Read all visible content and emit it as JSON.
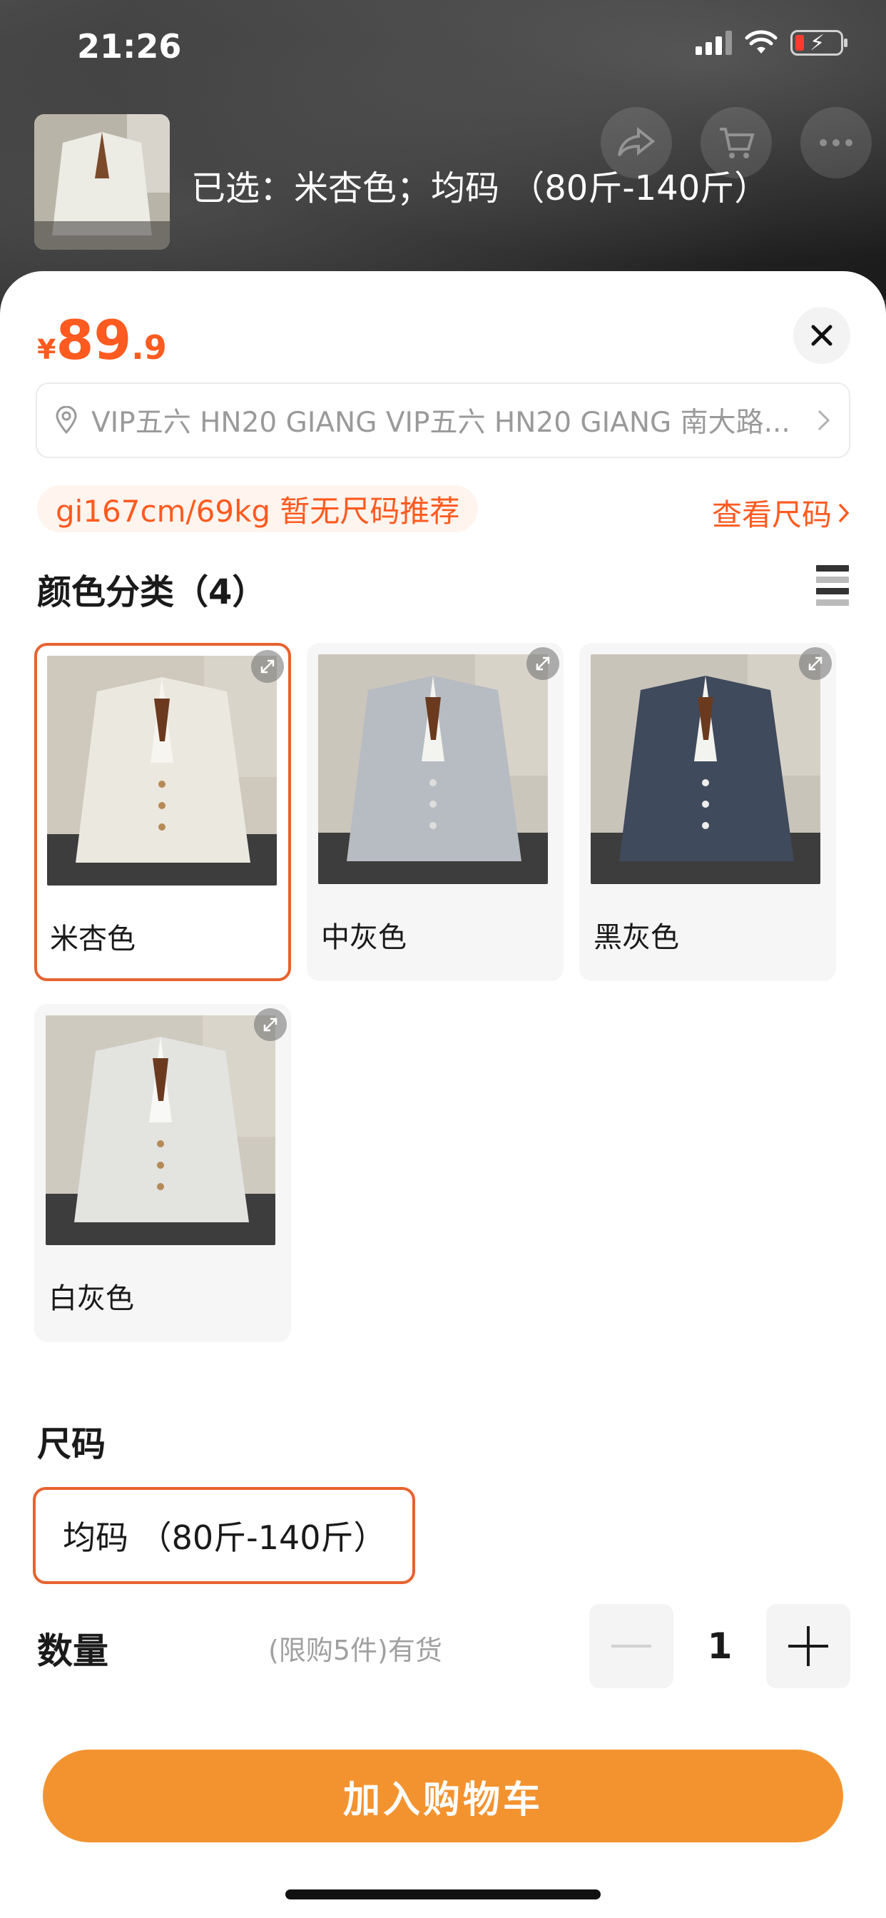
{
  "status_bar": {
    "time": "21:26"
  },
  "header": {
    "selected_summary": "已选：米杏色；均码 （80斤-140斤）"
  },
  "price": {
    "currency": "¥",
    "integer": "89",
    "decimal": ".9",
    "color": "#ff5a1f"
  },
  "address": {
    "text": "VIP五六 HN20 GIANG VIP五六 HN20 GIANG 南大路..."
  },
  "size_recommendation": {
    "text": "gi167cm/69kg 暂无尺码推荐",
    "link_label": "查看尺码"
  },
  "color_section": {
    "title": "颜色分类（4）",
    "options": [
      {
        "label": "米杏色",
        "selected": true,
        "swatch": "#e9e6dd"
      },
      {
        "label": "中灰色",
        "selected": false,
        "swatch": "#b7bcc2"
      },
      {
        "label": "黑灰色",
        "selected": false,
        "swatch": "#3f4a5c"
      },
      {
        "label": "白灰色",
        "selected": false,
        "swatch": "#e3e3e0"
      }
    ]
  },
  "size_section": {
    "title": "尺码",
    "options": [
      {
        "label": "均码 （80斤-140斤）",
        "selected": true
      }
    ]
  },
  "quantity": {
    "label": "数量",
    "note": "(限购5件)有货",
    "value": "1"
  },
  "actions": {
    "add_to_cart": "加入购物车"
  },
  "colors": {
    "accent": "#e8622f",
    "button": "#f39330"
  }
}
